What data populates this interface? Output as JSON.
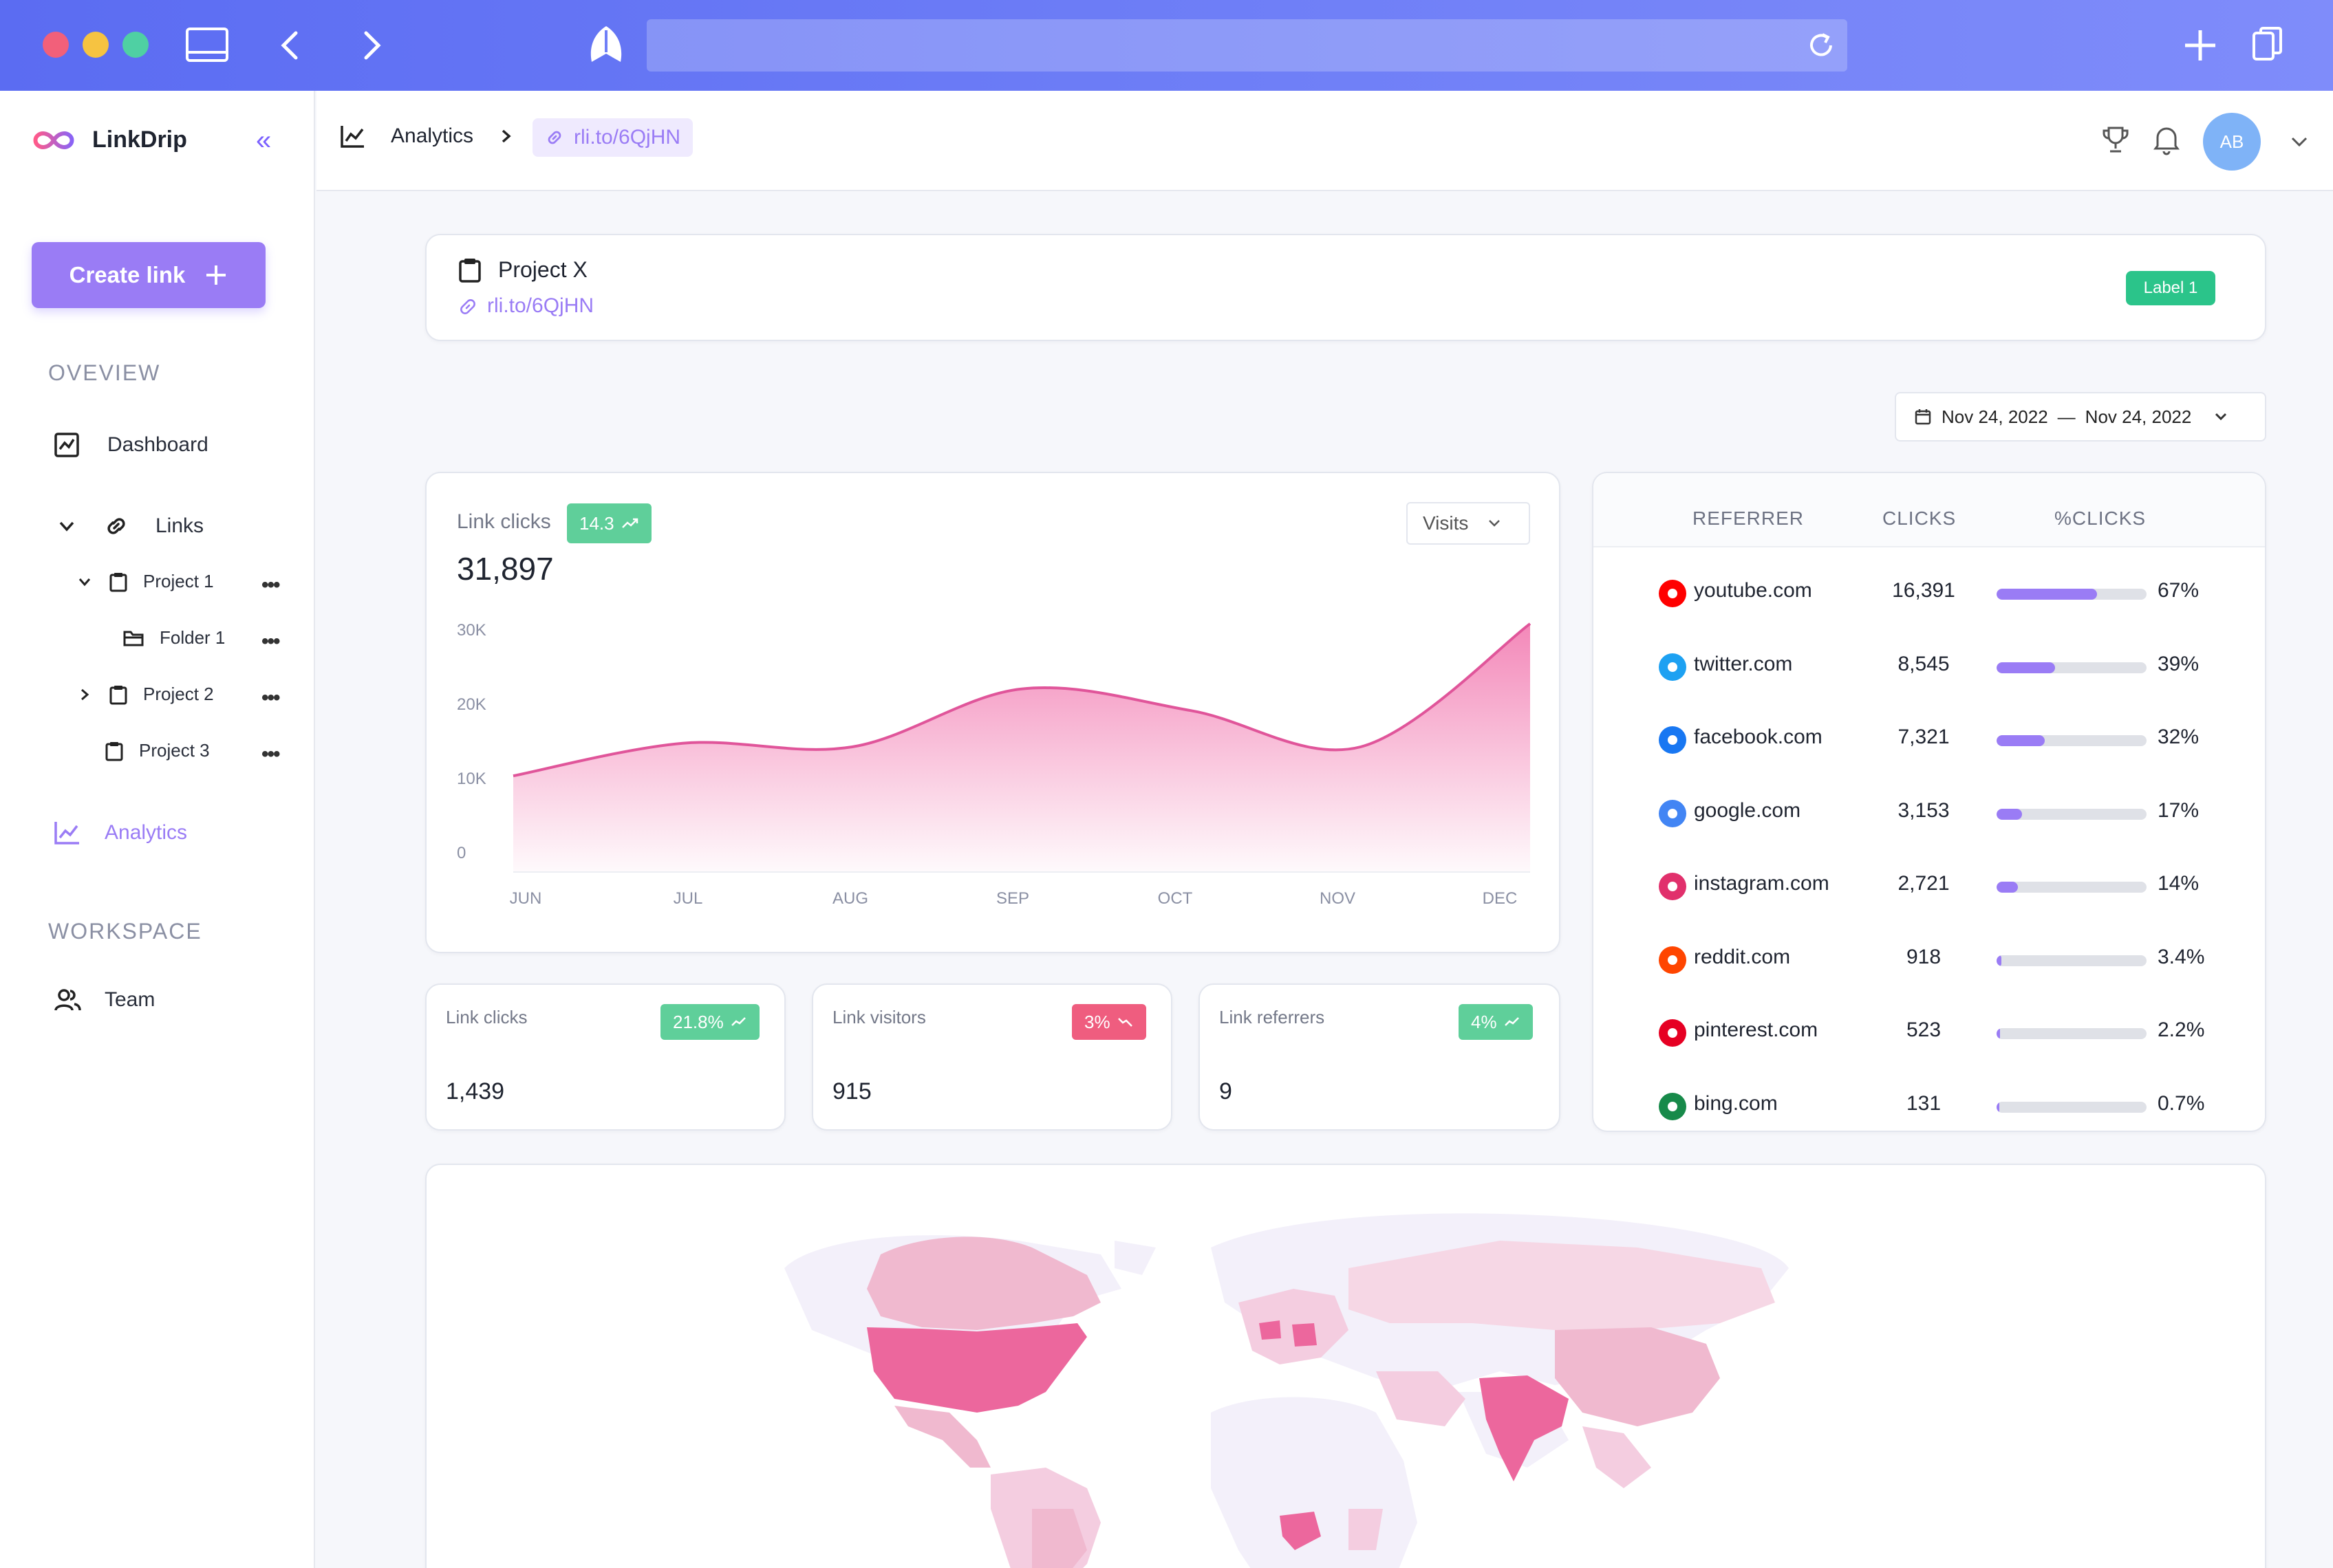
{
  "app": {
    "name": "LinkDrip"
  },
  "sidebar": {
    "create_label": "Create link",
    "overview_title": "OVEVIEW",
    "workspace_title": "WORKSPACE",
    "items": {
      "dashboard": "Dashboard",
      "links": "Links",
      "project1": "Project 1",
      "folder1": "Folder 1",
      "project2": "Project 2",
      "project3": "Project 3",
      "analytics": "Analytics",
      "team": "Team"
    }
  },
  "topbar": {
    "breadcrumb_analytics": "Analytics",
    "breadcrumb_link": "rli.to/6QjHN",
    "avatar_initials": "AB"
  },
  "project": {
    "name": "Project X",
    "link": "rli.to/6QjHN",
    "label": "Label 1"
  },
  "date_range": {
    "start": "Nov 24, 2022",
    "end": "Nov 24, 2022"
  },
  "clicks_card": {
    "title": "Link clicks",
    "badge": "14.3",
    "total": "31,897",
    "metric_select": "Visits"
  },
  "stats": [
    {
      "title": "Link clicks",
      "value": "1,439",
      "badge": "21.8%",
      "trend": "up"
    },
    {
      "title": "Link visitors",
      "value": "915",
      "badge": "3%",
      "trend": "down"
    },
    {
      "title": "Link referrers",
      "value": "9",
      "badge": "4%",
      "trend": "up"
    }
  ],
  "referrers": {
    "headers": [
      "REFERRER",
      "CLICKS",
      "%CLICKS"
    ],
    "rows": [
      {
        "site": "youtube.com",
        "clicks": "16,391",
        "pct": "67%",
        "share": 0.67,
        "icon": "youtube-icon",
        "color": "#ff0000"
      },
      {
        "site": "twitter.com",
        "clicks": "8,545",
        "pct": "39%",
        "share": 0.39,
        "icon": "twitter-icon",
        "color": "#1da1f2"
      },
      {
        "site": "facebook.com",
        "clicks": "7,321",
        "pct": "32%",
        "share": 0.32,
        "icon": "facebook-icon",
        "color": "#1877f2"
      },
      {
        "site": "google.com",
        "clicks": "3,153",
        "pct": "17%",
        "share": 0.17,
        "icon": "google-icon",
        "color": "#4285f4"
      },
      {
        "site": "instagram.com",
        "clicks": "2,721",
        "pct": "14%",
        "share": 0.14,
        "icon": "instagram-icon",
        "color": "#e1306c"
      },
      {
        "site": "reddit.com",
        "clicks": "918",
        "pct": "3.4%",
        "share": 0.034,
        "icon": "reddit-icon",
        "color": "#ff4500"
      },
      {
        "site": "pinterest.com",
        "clicks": "523",
        "pct": "2.2%",
        "share": 0.022,
        "icon": "pinterest-icon",
        "color": "#e60023"
      },
      {
        "site": "bing.com",
        "clicks": "131",
        "pct": "0.7%",
        "share": 0.007,
        "icon": "bing-icon",
        "color": "#178a4a"
      }
    ]
  },
  "colors": {
    "accent": "#9a7cf5",
    "chart_line": "#e0559a",
    "chart_fill": "#f27bb1",
    "positive": "#5fcf9a",
    "negative": "#ef5d7f",
    "label": "#2bc48a"
  },
  "chart_data": {
    "type": "area",
    "categories": [
      "JUN",
      "JUL",
      "AUG",
      "SEP",
      "OCT",
      "NOV",
      "DEC"
    ],
    "values": [
      11000,
      15500,
      15000,
      23000,
      20000,
      15000,
      32000
    ],
    "yticks": [
      "30K",
      "20K",
      "10K",
      "0"
    ],
    "ylim": [
      0,
      30000
    ],
    "grid": false
  }
}
